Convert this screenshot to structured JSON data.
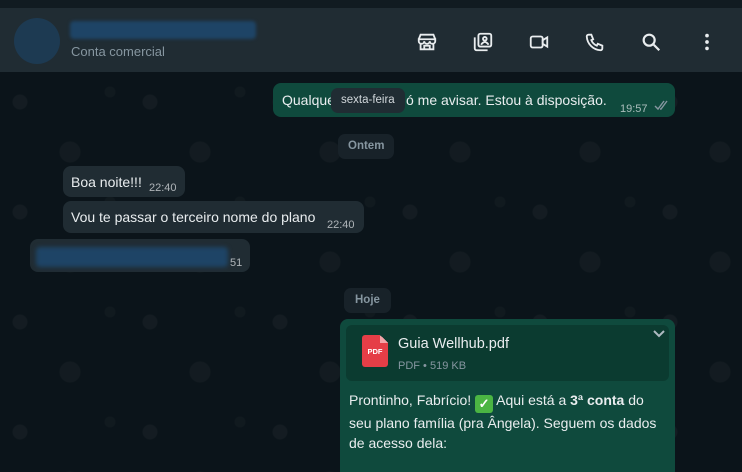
{
  "header": {
    "contact_subtitle": "Conta comercial",
    "icons": [
      "store-icon",
      "media-gallery-icon",
      "video-call-icon",
      "voice-call-icon",
      "search-icon",
      "menu-icon"
    ]
  },
  "chat": {
    "msg1": {
      "text_left": "Qualque",
      "text_right": "ó me avisar. Estou à disposição.",
      "time": "19:57"
    },
    "pill_friday": "sexta-feira",
    "pill_yesterday": "Ontem",
    "msg2": {
      "text": "Boa noite!!!",
      "time": "22:40"
    },
    "msg3": {
      "text": "Vou te passar o terceiro nome do plano",
      "time": "22:40"
    },
    "msg4": {
      "time_partial": "51"
    },
    "pill_today": "Hoje",
    "msg5": {
      "doc_name": "Guia Wellhub.pdf",
      "doc_type": "PDF",
      "doc_size": "519 KB",
      "pdf_label": "PDF",
      "text_a": "Prontinho, Fabrício! ",
      "emoji": "✓",
      "text_b": " Aqui está a ",
      "bold": "3ª conta",
      "text_c": " do seu plano família (pra Ângela). Seguem os dados de acesso dela:"
    }
  },
  "colors": {
    "header_bg": "#202c33",
    "incoming_bubble": "#202c33",
    "outgoing_bubble": "#0f4a3d",
    "pdf_red": "#e53e47"
  }
}
